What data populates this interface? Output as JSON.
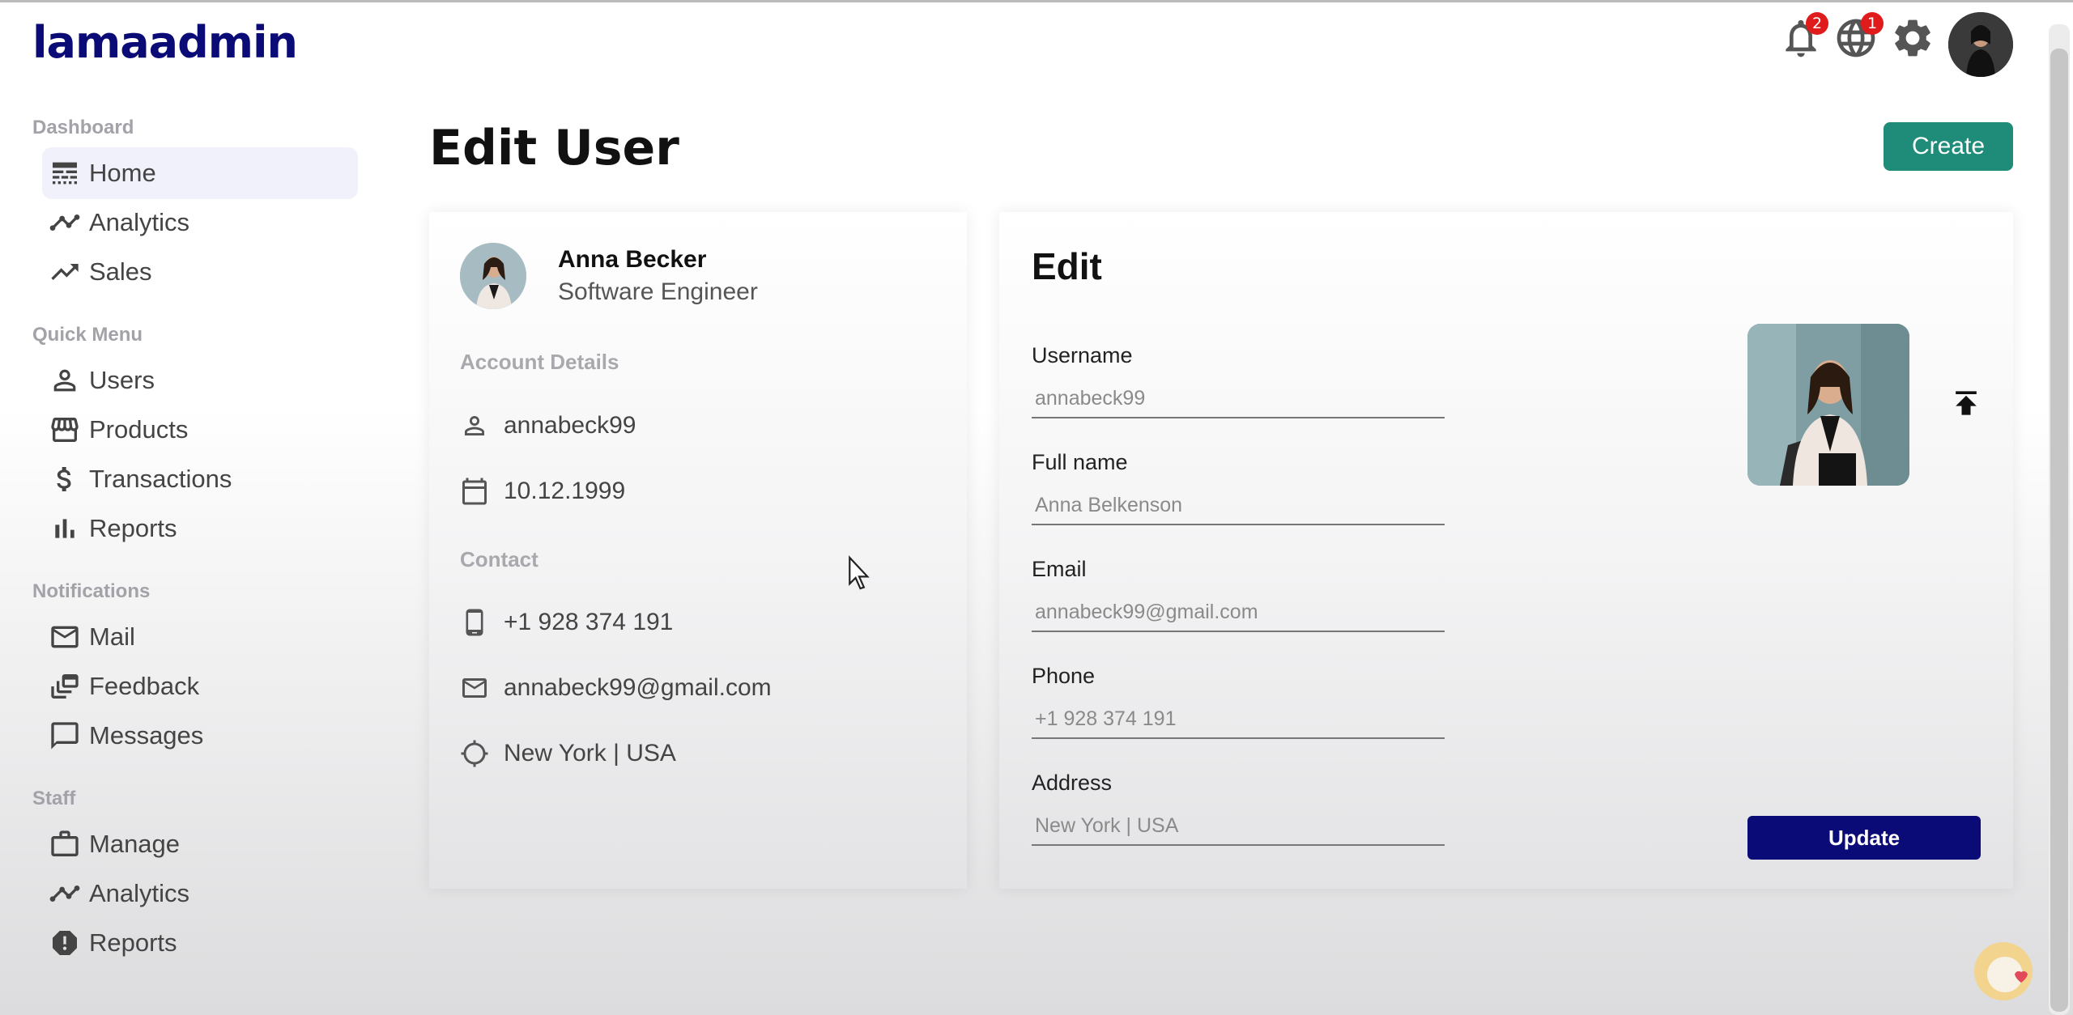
{
  "brand": {
    "logo": "lamaadmin",
    "color": "#0b0b78"
  },
  "topbar": {
    "icons": [
      {
        "name": "notifications-icon",
        "badge": "2"
      },
      {
        "name": "language-icon",
        "badge": "1"
      },
      {
        "name": "settings-icon"
      }
    ]
  },
  "sidebar": {
    "sections": [
      {
        "title": "Dashboard",
        "items": [
          {
            "label": "Home",
            "icon": "line-style-icon",
            "active": true
          },
          {
            "label": "Analytics",
            "icon": "timeline-icon"
          },
          {
            "label": "Sales",
            "icon": "trending-up-icon"
          }
        ]
      },
      {
        "title": "Quick Menu",
        "items": [
          {
            "label": "Users",
            "icon": "person-outline-icon"
          },
          {
            "label": "Products",
            "icon": "storefront-icon"
          },
          {
            "label": "Transactions",
            "icon": "dollar-icon"
          },
          {
            "label": "Reports",
            "icon": "bar-chart-icon"
          }
        ]
      },
      {
        "title": "Notifications",
        "items": [
          {
            "label": "Mail",
            "icon": "mail-outline-icon"
          },
          {
            "label": "Feedback",
            "icon": "dynamic-feed-icon"
          },
          {
            "label": "Messages",
            "icon": "chat-bubble-outline-icon"
          }
        ]
      },
      {
        "title": "Staff",
        "items": [
          {
            "label": "Manage",
            "icon": "work-outline-icon"
          },
          {
            "label": "Analytics",
            "icon": "timeline-icon"
          },
          {
            "label": "Reports",
            "icon": "report-icon"
          }
        ]
      }
    ]
  },
  "page": {
    "title": "Edit User",
    "create_label": "Create",
    "accent": "#1e8c78"
  },
  "show": {
    "name": "Anna Becker",
    "job": "Software Engineer",
    "account_title": "Account Details",
    "username": "annabeck99",
    "birthday": "10.12.1999",
    "contact_title": "Contact",
    "phone": "+1 928 374 191",
    "email": "annabeck99@gmail.com",
    "address": "New York | USA"
  },
  "update": {
    "title": "Edit",
    "fields": {
      "username": {
        "label": "Username",
        "placeholder": "annabeck99"
      },
      "fullname": {
        "label": "Full name",
        "placeholder": "Anna Belkenson"
      },
      "email": {
        "label": "Email",
        "placeholder": "annabeck99@gmail.com"
      },
      "phone": {
        "label": "Phone",
        "placeholder": "+1 928 374 191"
      },
      "address": {
        "label": "Address",
        "placeholder": "New York | USA"
      }
    },
    "button_label": "Update",
    "button_color": "#0b0b78"
  }
}
